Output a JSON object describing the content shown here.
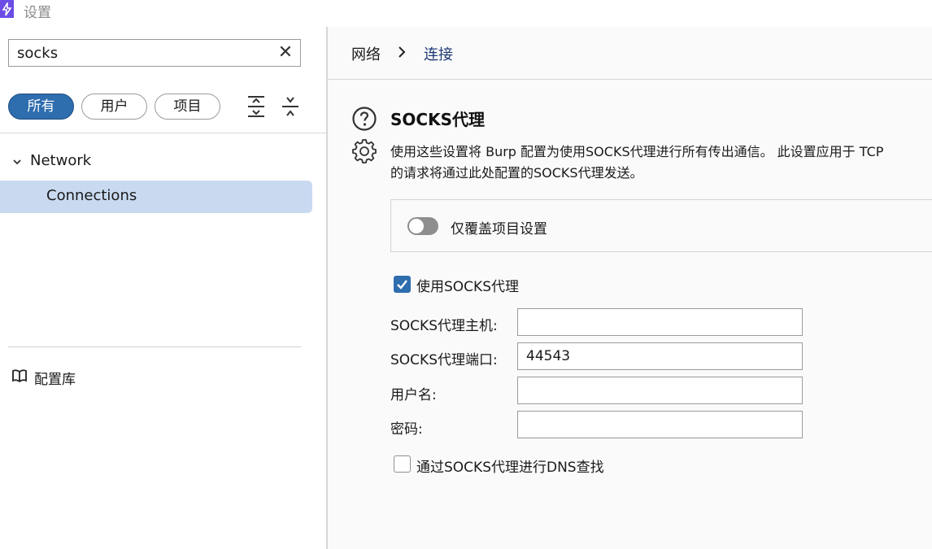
{
  "window": {
    "title": "设置"
  },
  "search": {
    "value": "socks",
    "clear_glyph": "✕"
  },
  "filters": [
    {
      "label": "所有",
      "active": true
    },
    {
      "label": "用户",
      "active": false
    },
    {
      "label": "项目",
      "active": false
    }
  ],
  "tree": {
    "node_label": "Network",
    "child_label": "Connections",
    "library_label": "配置库"
  },
  "breadcrumb": {
    "parent": "网络",
    "current": "连接"
  },
  "section": {
    "title": "SOCKS代理",
    "desc_line1": "使用这些设置将 Burp 配置为使用SOCKS代理进行所有传出通信。 此设置应用于 TCP",
    "desc_line2": "的请求将通过此处配置的SOCKS代理发送。"
  },
  "override": {
    "label": "仅覆盖项目设置",
    "enabled": false
  },
  "use_socks": {
    "label": "使用SOCKS代理",
    "checked": true
  },
  "fields": {
    "host": {
      "label": "SOCKS代理主机:",
      "value": ""
    },
    "port": {
      "label": "SOCKS代理端口:",
      "value": "44543"
    },
    "username": {
      "label": "用户名:",
      "value": ""
    },
    "password": {
      "label": "密码:",
      "value": ""
    }
  },
  "dns": {
    "label": "通过SOCKS代理进行DNS查找",
    "checked": false
  },
  "colors": {
    "accent": "#2e6dae",
    "selected_row": "#c9daf0",
    "app_icon": "#6b4de6",
    "link": "#1e3a78"
  }
}
